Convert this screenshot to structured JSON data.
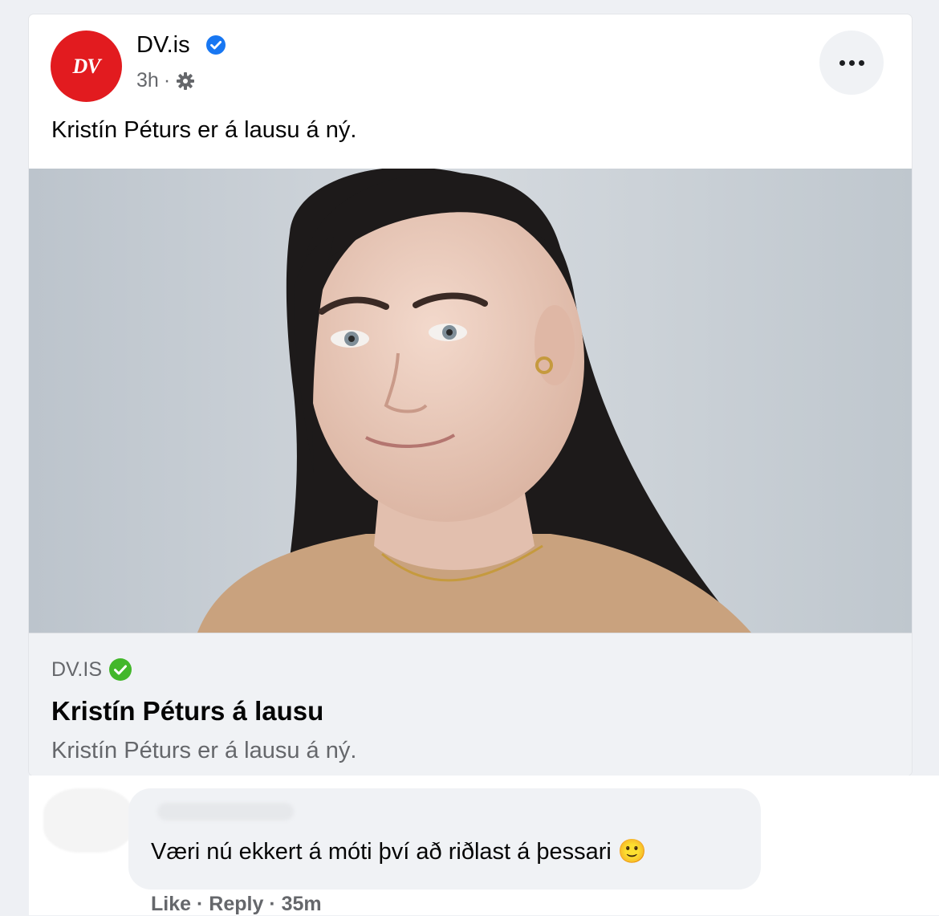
{
  "post": {
    "page_name": "DV.is",
    "avatar_text": "DV",
    "time": "3h",
    "separator": "·",
    "privacy_icon": "gear-icon",
    "more_icon": "more-icon",
    "text": "Kristín Péturs er á lausu á ný."
  },
  "link_preview": {
    "domain": "DV.IS",
    "title": "Kristín Péturs á lausu",
    "description": "Kristín Péturs er á lausu á ný."
  },
  "comment": {
    "text": "Væri nú ekkert á móti því að riðlast á þessari",
    "emoji": "🙂",
    "actions": {
      "like": "Like",
      "reply": "Reply",
      "time": "35m",
      "separator": "·"
    }
  },
  "colors": {
    "brand_red": "#e21b1f",
    "verified_blue": "#1877f2",
    "verified_green": "#42b72a"
  }
}
